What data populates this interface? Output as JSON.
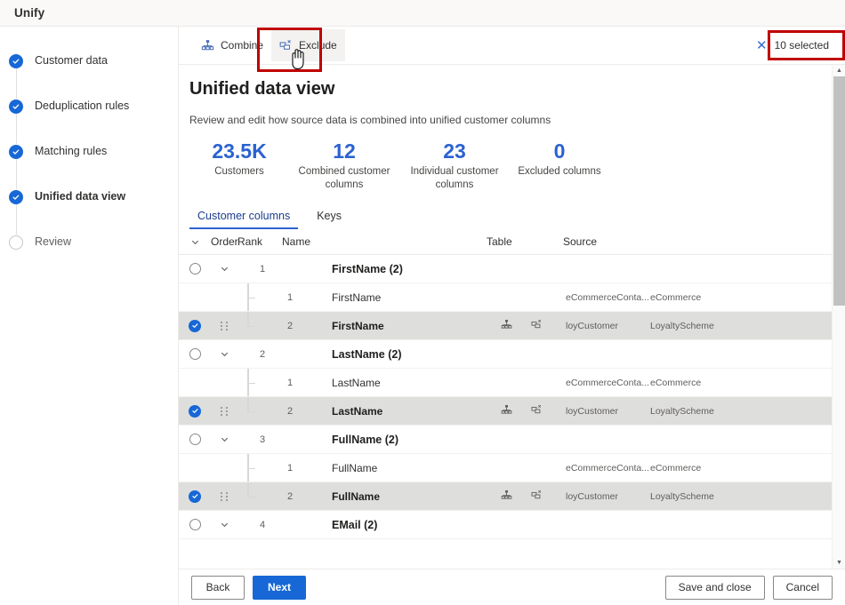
{
  "window": {
    "title": "Unify"
  },
  "sidebar": {
    "steps": [
      {
        "label": "Customer data",
        "state": "done"
      },
      {
        "label": "Deduplication rules",
        "state": "done"
      },
      {
        "label": "Matching rules",
        "state": "done"
      },
      {
        "label": "Unified data view",
        "state": "done_active"
      },
      {
        "label": "Review",
        "state": "todo"
      }
    ]
  },
  "commandbar": {
    "combine_label": "Combine",
    "exclude_label": "Exclude",
    "selected_label": "10 selected"
  },
  "main": {
    "page_title": "Unified data view",
    "page_subtitle": "Review and edit how source data is combined into unified customer columns",
    "stats": [
      {
        "value": "23.5K",
        "caption": "Customers"
      },
      {
        "value": "12",
        "caption": "Combined customer columns"
      },
      {
        "value": "23",
        "caption": "Individual customer columns"
      },
      {
        "value": "0",
        "caption": "Excluded columns"
      }
    ],
    "tabs": [
      {
        "label": "Customer columns",
        "active": true
      },
      {
        "label": "Keys",
        "active": false
      }
    ],
    "table": {
      "headers": {
        "expand": "",
        "order": "Order",
        "rank": "Rank",
        "name": "Name",
        "table": "Table",
        "source": "Source"
      },
      "rows": [
        {
          "type": "group",
          "order": "1",
          "name": "FirstName (2)"
        },
        {
          "type": "child",
          "rank": "1",
          "name": "FirstName",
          "table": "eCommerceConta...",
          "source": "eCommerce",
          "selected": false
        },
        {
          "type": "child",
          "rank": "2",
          "name": "FirstName",
          "table": "loyCustomer",
          "source": "LoyaltyScheme",
          "selected": true
        },
        {
          "type": "group",
          "order": "2",
          "name": "LastName (2)"
        },
        {
          "type": "child",
          "rank": "1",
          "name": "LastName",
          "table": "eCommerceConta...",
          "source": "eCommerce",
          "selected": false
        },
        {
          "type": "child",
          "rank": "2",
          "name": "LastName",
          "table": "loyCustomer",
          "source": "LoyaltyScheme",
          "selected": true
        },
        {
          "type": "group",
          "order": "3",
          "name": "FullName (2)"
        },
        {
          "type": "child",
          "rank": "1",
          "name": "FullName",
          "table": "eCommerceConta...",
          "source": "eCommerce",
          "selected": false
        },
        {
          "type": "child",
          "rank": "2",
          "name": "FullName",
          "table": "loyCustomer",
          "source": "LoyaltyScheme",
          "selected": true
        },
        {
          "type": "group",
          "order": "4",
          "name": "EMail (2)"
        }
      ]
    }
  },
  "footer": {
    "back_label": "Back",
    "next_label": "Next",
    "save_label": "Save and close",
    "cancel_label": "Cancel"
  },
  "colors": {
    "accent": "#1768d6",
    "stat_number": "#2b62d0",
    "annotation": "#c00000",
    "selected_row": "#dededd"
  }
}
